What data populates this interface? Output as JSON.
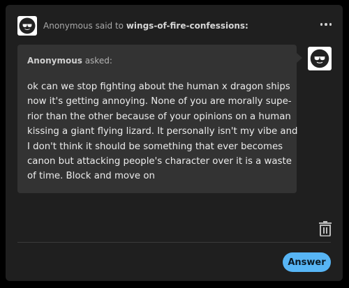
{
  "header": {
    "asker": "Anonymous",
    "said_to_text": "said to",
    "blog_name": "wings-of-fire-confessions:",
    "more_icon": "more-horizontal-icon"
  },
  "ask": {
    "asker": "Anonymous",
    "asked_text": "asked:",
    "lines": [
      "ok can we stop fighting about the human x dragon ships",
      "now it's getting annoying. None of you are morally supe-",
      "rior than the other because of your opinions on a human",
      "kissing a giant flying lizard. It personally isn't my vibe and",
      "I don't think it should be something that ever becomes",
      "canon but attacking people's character over it is a waste",
      "of time. Block and move on"
    ]
  },
  "avatars": {
    "icon": "anonymous-sunglasses-avatar"
  },
  "actions": {
    "delete_icon": "trash-icon",
    "answer_label": "Answer"
  },
  "colors": {
    "card_bg": "#1f1f1f",
    "bubble_bg": "#333333",
    "accent": "#57b5f5"
  }
}
